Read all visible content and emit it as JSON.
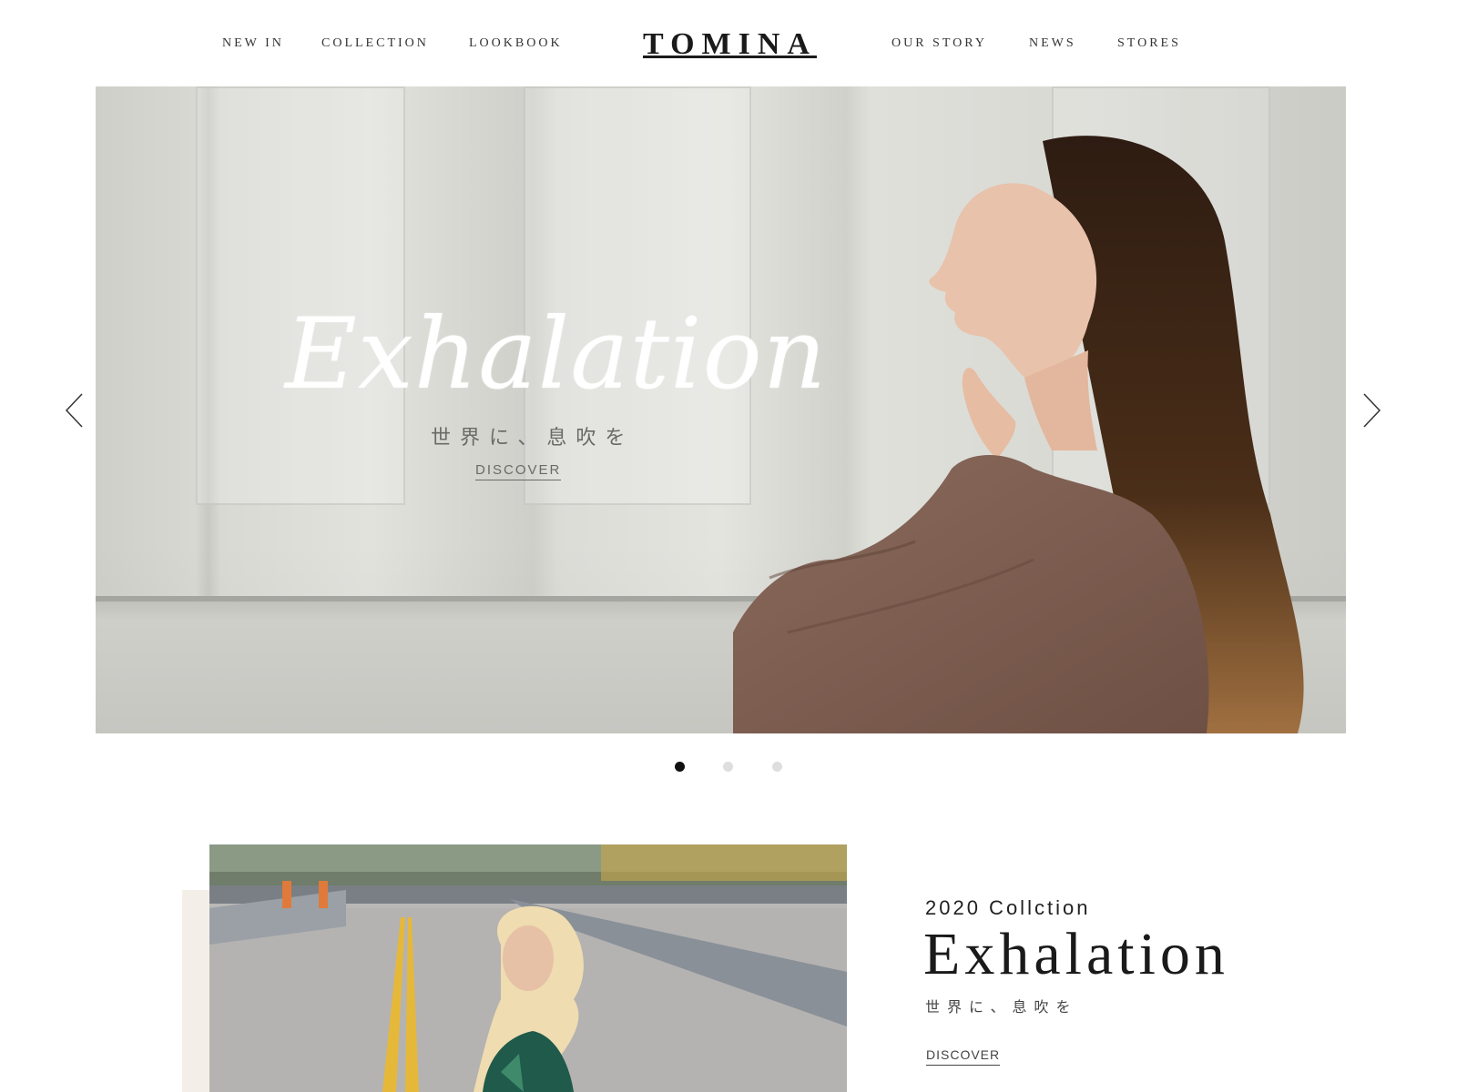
{
  "header": {
    "nav_left": [
      "NEW IN",
      "COLLECTION",
      "LOOKBOOK"
    ],
    "logo": "TOMINA",
    "nav_right": [
      "OUR STORY",
      "NEWS",
      "STORES"
    ]
  },
  "hero": {
    "script_title": "Exhalation",
    "subtitle": "世界に、息吹を",
    "discover_label": "DISCOVER",
    "slide_count": 3,
    "active_slide": 1
  },
  "collection": {
    "year_label": "2020 Collction",
    "title": "Exhalation",
    "subtitle": "世界に、息吹を",
    "discover_label": "DISCOVER"
  },
  "icons": {
    "prev": "chevron-left-icon",
    "next": "chevron-right-icon"
  }
}
